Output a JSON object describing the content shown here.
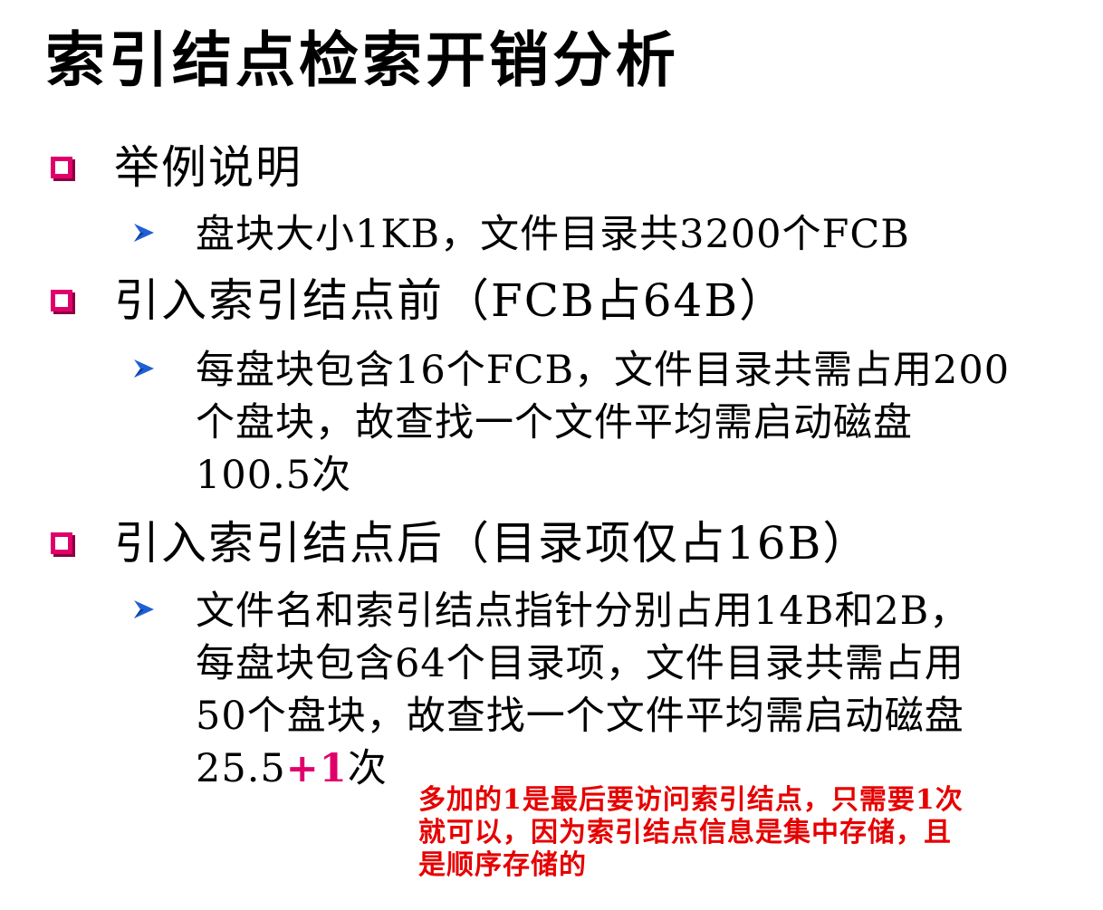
{
  "title": "索引结点检索开销分析",
  "sections": [
    {
      "label": "举例说明",
      "items": [
        {
          "lines": [
            "盘块大小1KB，文件目录共3200个FCB"
          ]
        }
      ]
    },
    {
      "label": "引入索引结点前（FCB占64B）",
      "items": [
        {
          "lines": [
            "每盘块包含16个FCB，文件目录共需占用200",
            "个盘块，故查找一个文件平均需启动磁盘",
            "100.5次"
          ]
        }
      ]
    },
    {
      "label": "引入索引结点后（目录项仅占16B）",
      "items": [
        {
          "lines": [
            "文件名和索引结点指针分别占用14B和2B，",
            "每盘块包含64个目录项，文件目录共需占用",
            "50个盘块，故查找一个文件平均需启动磁盘"
          ],
          "last_line_prefix": "25.5",
          "last_line_accent": "+1",
          "last_line_suffix": "次"
        }
      ]
    }
  ],
  "note": {
    "lines": [
      "多加的1是最后要访问索引结点，只需要1次",
      "就可以，因为索引结点信息是集中存储，且",
      "是顺序存储的"
    ]
  },
  "colors": {
    "bullet": "#e0006b",
    "arrow": "#1f5fd6",
    "accent": "#e0006b",
    "note": "#e60000"
  }
}
